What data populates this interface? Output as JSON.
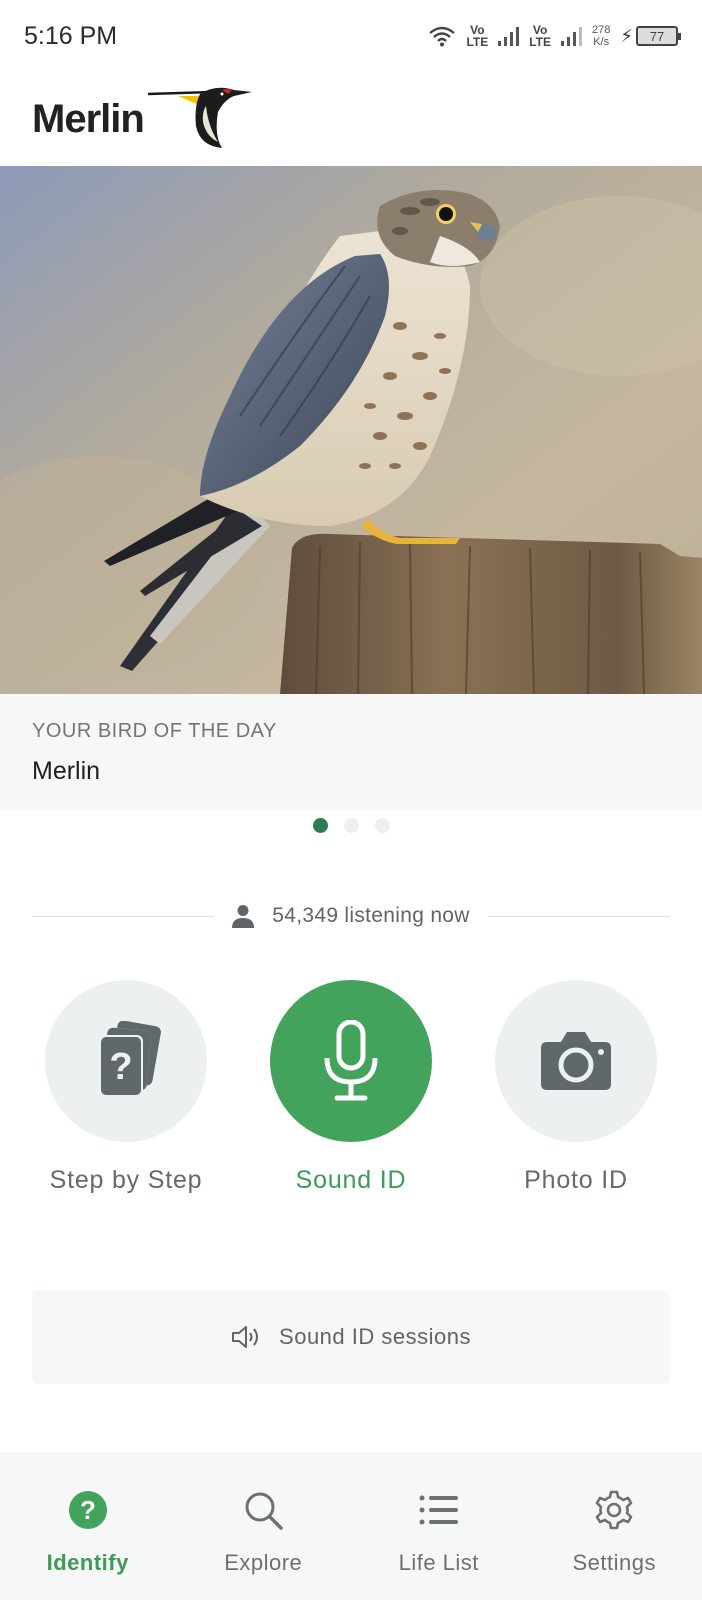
{
  "status_bar": {
    "time": "5:16 PM",
    "sim1_top": "Vo",
    "sim1_bottom": "LTE",
    "sim2_top": "Vo",
    "sim2_bottom": "LTE",
    "speed_value": "278",
    "speed_unit": "K/s",
    "battery": "77"
  },
  "header": {
    "logo_text": "Merlin"
  },
  "bird_of_day": {
    "kicker": "YOUR BIRD OF THE DAY",
    "name": "Merlin",
    "carousel_active_index": 0,
    "carousel_count": 3
  },
  "listening": {
    "text": "54,349 listening now"
  },
  "id_buttons": {
    "step_by_step": "Step by Step",
    "sound_id": "Sound ID",
    "photo_id": "Photo ID"
  },
  "sessions": {
    "label": "Sound ID sessions"
  },
  "bottom_nav": {
    "identify": "Identify",
    "explore": "Explore",
    "life_list": "Life List",
    "settings": "Settings"
  },
  "colors": {
    "accent_green": "#43a25b",
    "label_green": "#3f9957",
    "dot_active": "#2e7d4f"
  }
}
